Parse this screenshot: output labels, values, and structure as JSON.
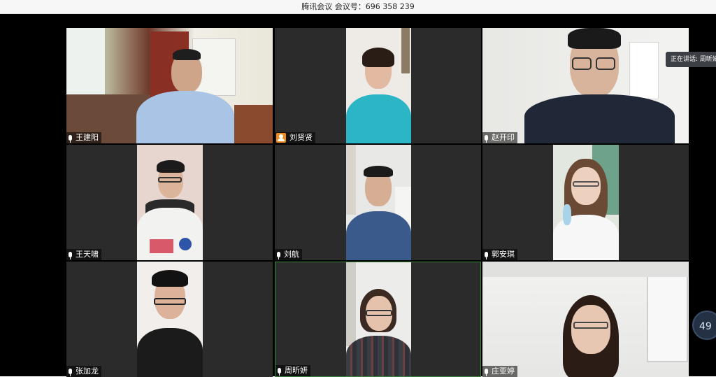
{
  "window": {
    "title": "腾讯会议 会议号：696 358 239"
  },
  "speaking": {
    "label": "正在讲话: 周昕妍"
  },
  "badge": {
    "value": "49"
  },
  "participants": [
    {
      "name": "王建阳",
      "icon": "mic-icon"
    },
    {
      "name": "刘贤贤",
      "icon": "host-icon"
    },
    {
      "name": "赵开印",
      "icon": "mic-icon"
    },
    {
      "name": "王天啸",
      "icon": "mic-icon"
    },
    {
      "name": "刘航",
      "icon": "mic-icon"
    },
    {
      "name": "郭安琪",
      "icon": "mic-icon"
    },
    {
      "name": "张加龙",
      "icon": "mic-icon"
    },
    {
      "name": "周昕妍",
      "icon": "mic-icon"
    },
    {
      "name": "庄亚婷",
      "icon": "mic-icon"
    }
  ],
  "colors": {
    "tile_bg": "#2b2b2b",
    "active_border": "#3a8a3a",
    "host_orange": "#f08c1e"
  }
}
